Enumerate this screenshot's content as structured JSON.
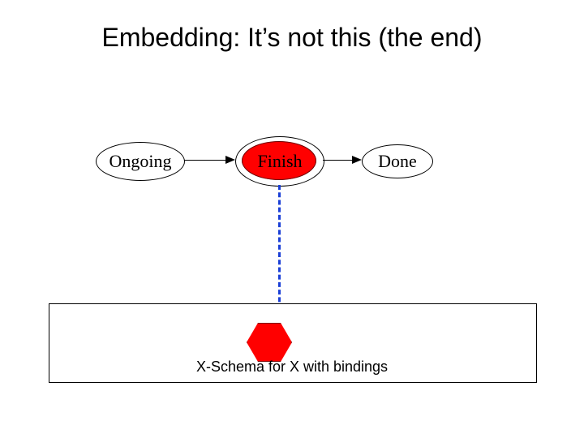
{
  "title": "Embedding: It’s not this (the end)",
  "nodes": {
    "ongoing": "Ongoing",
    "finish": "Finish",
    "done": "Done"
  },
  "box_caption": "X-Schema for X with  bindings"
}
